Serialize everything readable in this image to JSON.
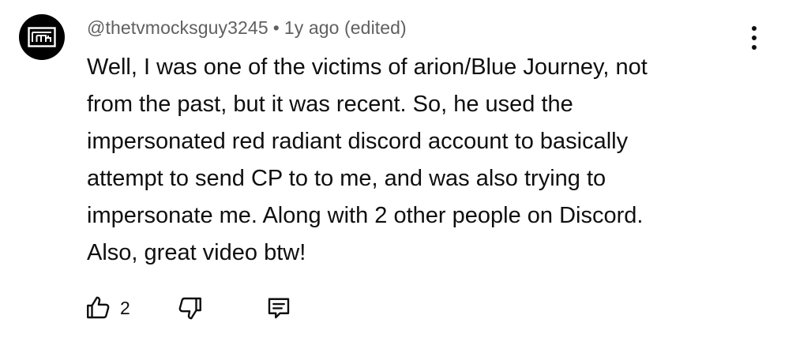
{
  "comment": {
    "author": "@thetvmocksguy3245",
    "separator": "•",
    "time": "1y ago",
    "edited": "(edited)",
    "avatar_icon": "tvmg-logo-icon",
    "text_lines": [
      "Well, I was one of the victims of arion/Blue Journey, not",
      "from the past, but it was recent. So, he used the",
      "impersonated red radiant discord account to basically",
      "attempt to send CP to to me, and was also trying to",
      "impersonate me. Along with 2 other people on Discord.",
      "Also, great video btw!"
    ],
    "like_count": "2",
    "icons": {
      "like": "thumbs-up-icon",
      "dislike": "thumbs-down-icon",
      "reply": "reply-comment-icon",
      "more": "more-vertical-icon"
    },
    "colors": {
      "text": "#0f0f0f",
      "meta": "#606060",
      "avatar_bg": "#000000"
    }
  }
}
